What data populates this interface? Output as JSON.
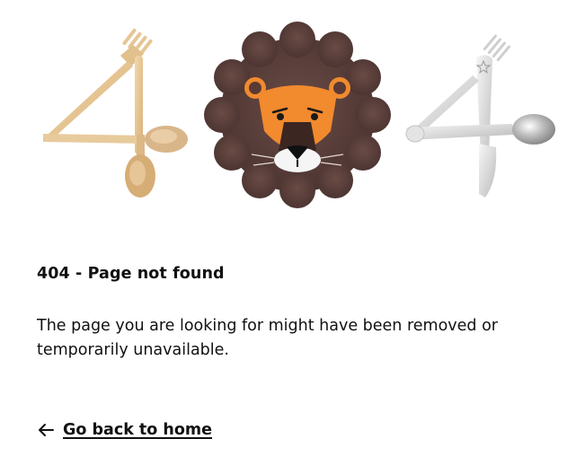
{
  "error": {
    "title": "404 - Page not found",
    "message": "The page you are looking for might have been removed or temporarily unavailable."
  },
  "navigation": {
    "home_link_label": "Go back to home",
    "home_link_icon": "arrow-left-icon"
  },
  "illustration": {
    "first_digit_icon": "wooden-utensils-four-icon",
    "zero_icon": "lion-cushion-icon",
    "last_digit_icon": "steel-cutlery-four-icon"
  },
  "colors": {
    "text": "#111111",
    "background": "#ffffff"
  }
}
